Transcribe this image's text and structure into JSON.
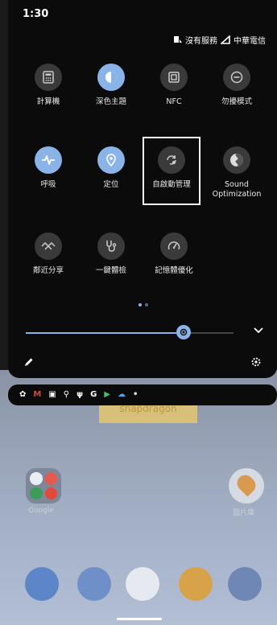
{
  "status_bar": {
    "time": "1:30",
    "no_service": "沒有服務",
    "carrier": "中華電信"
  },
  "tiles": [
    {
      "label": "計算機",
      "icon": "calculator-icon",
      "active": false
    },
    {
      "label": "深色主題",
      "icon": "dark-theme-icon",
      "active": true
    },
    {
      "label": "NFC",
      "icon": "nfc-icon",
      "active": false
    },
    {
      "label": "勿擾模式",
      "icon": "do-not-disturb-icon",
      "active": false
    },
    {
      "label": "呼吸",
      "icon": "breathing-icon",
      "active": true
    },
    {
      "label": "定位",
      "icon": "location-icon",
      "active": true
    },
    {
      "label": "自啟動管理",
      "icon": "auto-start-icon",
      "active": false,
      "highlighted": true
    },
    {
      "label": "Sound Optimization",
      "icon": "sound-optimization-icon",
      "active": false
    },
    {
      "label": "鄰近分享",
      "icon": "nearby-share-icon",
      "active": false
    },
    {
      "label": "一鍵體檢",
      "icon": "health-check-icon",
      "active": false
    },
    {
      "label": "記憶體優化",
      "icon": "memory-optimize-icon",
      "active": false
    }
  ],
  "pager": {
    "pages": 2,
    "current": 1
  },
  "brightness": {
    "level": 0.76
  },
  "home": {
    "sticker_text": "snapdragon",
    "folder_label": "Google",
    "gallery_label": "圖片庫"
  },
  "colors": {
    "accent": "#8ab4e8",
    "tile_off": "#3a3a3a",
    "panel": "#0b0b0b"
  }
}
